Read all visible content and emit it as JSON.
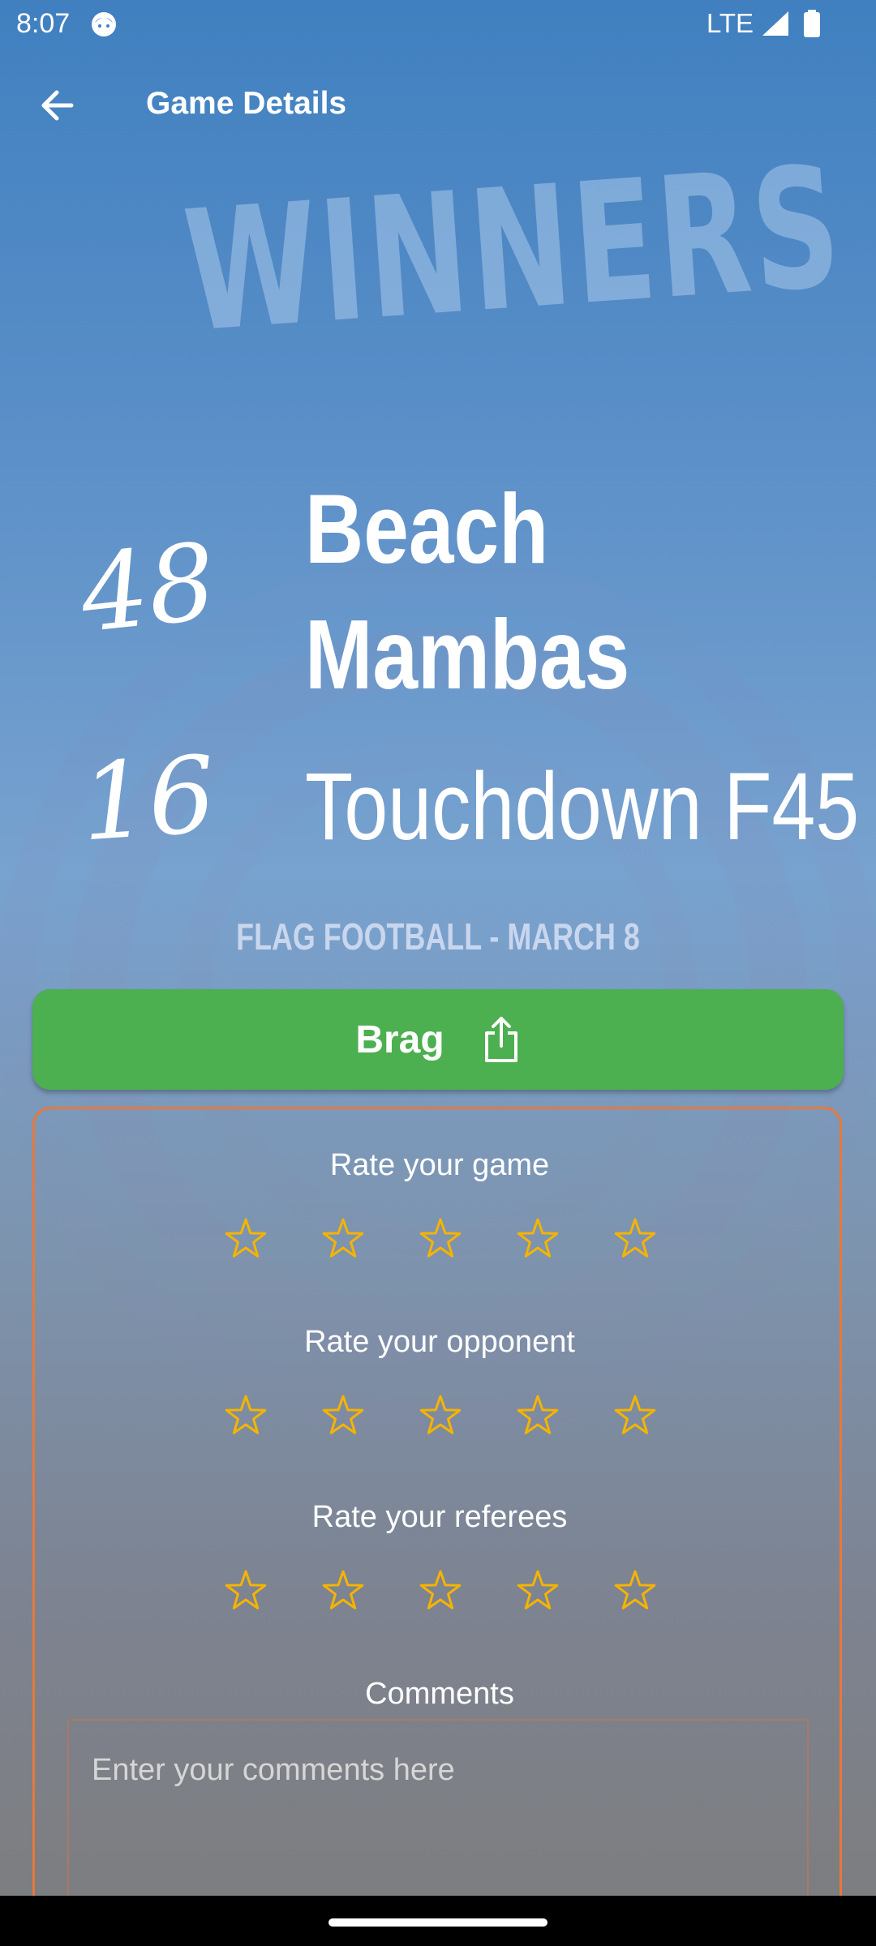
{
  "status_bar": {
    "time": "8:07",
    "network": "LTE",
    "icons": [
      "face-icon",
      "signal-icon",
      "battery-icon"
    ]
  },
  "app_bar": {
    "title": "Game Details",
    "back_icon": "arrow-back-icon"
  },
  "result": {
    "heading": "WINNERS",
    "winner": {
      "team": "Beach Mambas",
      "score": "48"
    },
    "loser": {
      "team": "Touchdown F45",
      "score": "16"
    },
    "subtitle": "FLAG FOOTBALL - MARCH 8"
  },
  "brag_button": {
    "label": "Brag",
    "icon": "share-icon",
    "color": "#4caf50"
  },
  "rating": {
    "border_color": "#e8783a",
    "star_color": "#f5b400",
    "sections": [
      {
        "label": "Rate your game",
        "rating": 0,
        "max": 5
      },
      {
        "label": "Rate your opponent",
        "rating": 0,
        "max": 5
      },
      {
        "label": "Rate your referees",
        "rating": 0,
        "max": 5
      }
    ],
    "comments": {
      "label": "Comments",
      "placeholder": "Enter your comments here",
      "value": ""
    }
  }
}
